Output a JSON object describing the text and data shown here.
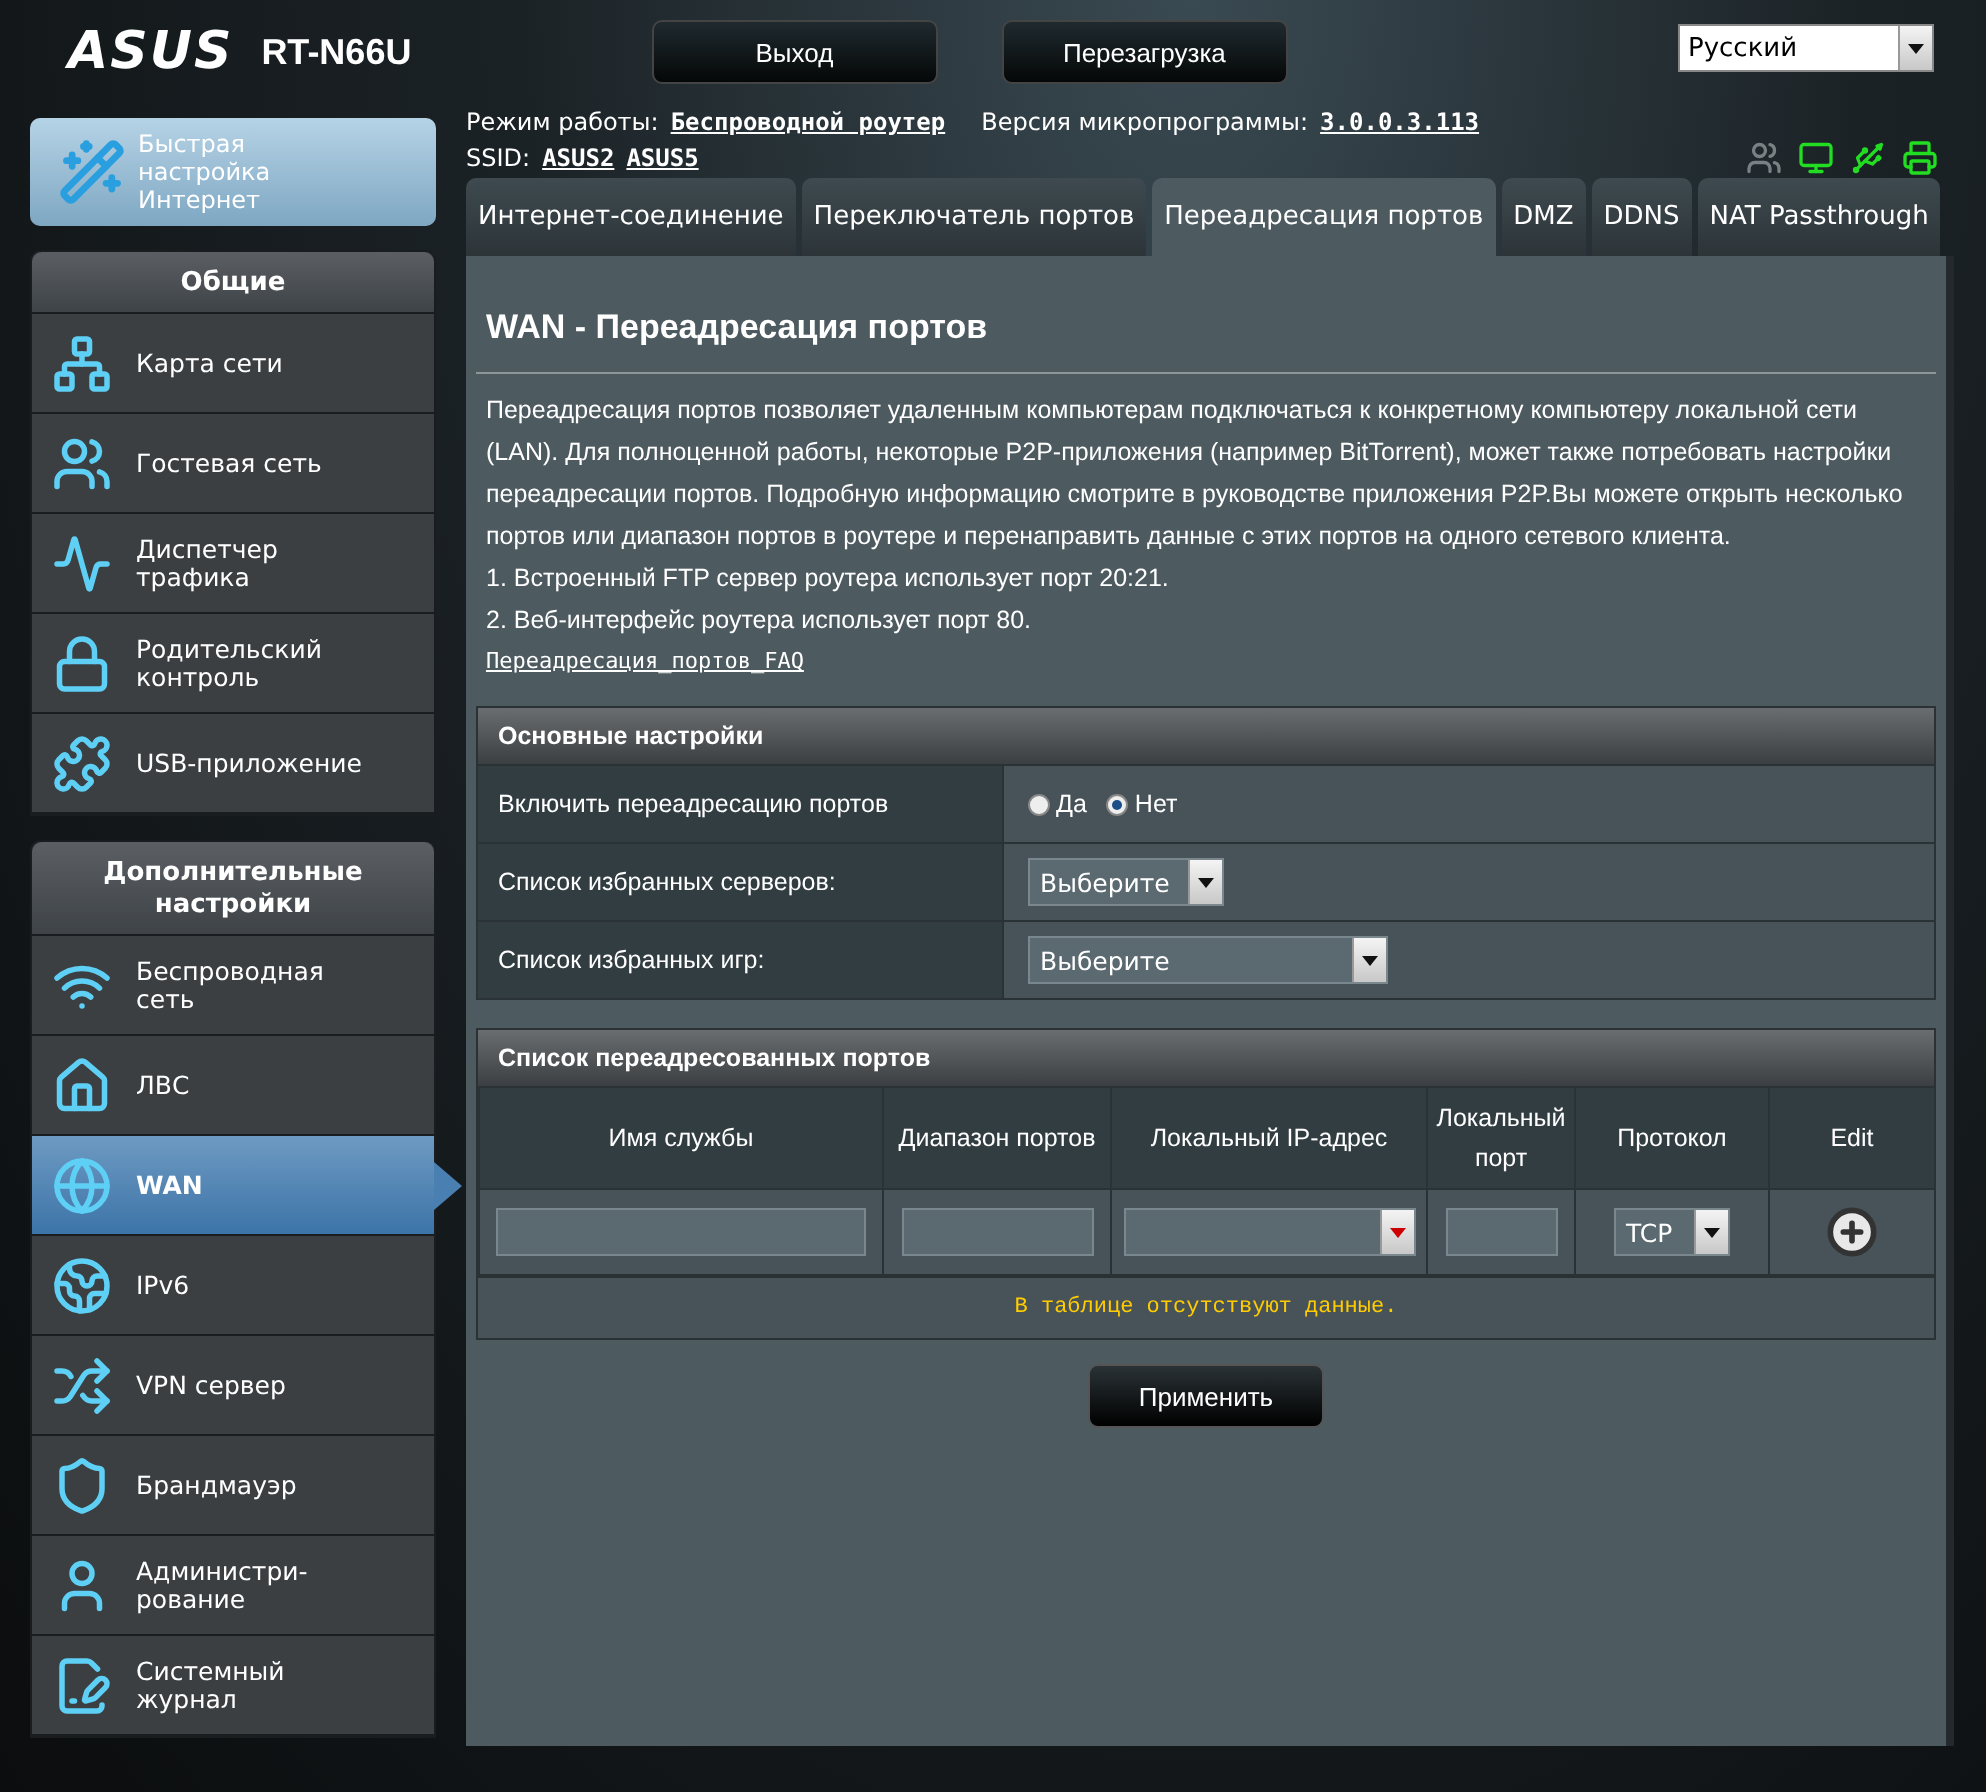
{
  "header": {
    "logo": "ASUS",
    "model": "RT-N66U",
    "buttons": [
      "Выход",
      "Перезагрузка"
    ],
    "language": "Русский"
  },
  "info": {
    "mode_label": "Режим работы:",
    "mode_value": "Беспроводной роутер",
    "firmware_label": "Версия микропрограммы:",
    "firmware_value": "3.0.0.3.113",
    "ssid_label": "SSID:",
    "ssids": [
      "ASUS2",
      "ASUS5"
    ]
  },
  "status_indicators": [
    {
      "on": false
    },
    {
      "on": true
    },
    {
      "on": true
    },
    {
      "on": true
    }
  ],
  "quick_setup": "Быстрая настройка Интернет",
  "sidebar": [
    {
      "title": "Общие",
      "items": [
        {
          "label": "Карта сети",
          "selected": false
        },
        {
          "label": "Гостевая сеть",
          "selected": false
        },
        {
          "label": "Диспетчер трафика",
          "selected": false
        },
        {
          "label": "Родительский контроль",
          "selected": false
        },
        {
          "label": "USB-приложение",
          "selected": false
        }
      ]
    },
    {
      "title": "Дополнительные настройки",
      "items": [
        {
          "label": "Беспроводная сеть",
          "selected": false
        },
        {
          "label": "ЛВС",
          "selected": false
        },
        {
          "label": "WAN",
          "selected": true
        },
        {
          "label": "IPv6",
          "selected": false
        },
        {
          "label": "VPN сервер",
          "selected": false
        },
        {
          "label": "Брандмауэр",
          "selected": false
        },
        {
          "label": "Администри-рование",
          "selected": false
        },
        {
          "label": "Системный журнал",
          "selected": false
        }
      ]
    }
  ],
  "tabs": [
    {
      "label": "Интернет-соединение",
      "selected": false
    },
    {
      "label": "Переключатель портов",
      "selected": false
    },
    {
      "label": "Переадресация портов",
      "selected": true
    },
    {
      "label": "DMZ",
      "selected": false
    },
    {
      "label": "DDNS",
      "selected": false
    },
    {
      "label": "NAT Passthrough",
      "selected": false
    }
  ],
  "content": {
    "title": "WAN - Переадресация портов",
    "description": "Переадресация портов позволяет удаленным компьютерам подключаться к конкретному компьютеру локальной сети (LAN). Для полноценной работы, некоторые P2P-приложения (например BitTorrent), может также потребовать настройки переадресации портов. Подробную информацию смотрите в руководстве приложения P2P.Вы можете открыть несколько портов или диапазон портов в роутере и перенаправить данные с этих портов на одного сетевого клиента.",
    "notes": [
      "1. Встроенный FTP сервер роутера использует порт 20:21.",
      "2. Веб-интерфейс роутера использует порт 80."
    ],
    "faq_link": "Переадресация_портов_FAQ"
  },
  "basic_settings": {
    "title": "Основные настройки",
    "rows": [
      {
        "kind": "radio",
        "label": "Включить переадресацию портов",
        "options": [
          {
            "label": "Да",
            "selected": false
          },
          {
            "label": "Нет",
            "selected": true
          }
        ]
      },
      {
        "kind": "select",
        "label": "Список избранных серверов:",
        "value": "Выберите"
      },
      {
        "kind": "select-wide",
        "label": "Список избранных игр:",
        "value": "Выберите"
      }
    ]
  },
  "forward_list": {
    "title": "Список переадресованных портов",
    "columns": [
      "Имя службы",
      "Диапазон портов",
      "Локальный IP-адрес",
      "Локальный порт",
      "Протокол",
      "Edit"
    ],
    "entry": {
      "protocol": "TCP"
    },
    "empty_message": "В таблице отсутствуют данные."
  },
  "apply": "Применить"
}
